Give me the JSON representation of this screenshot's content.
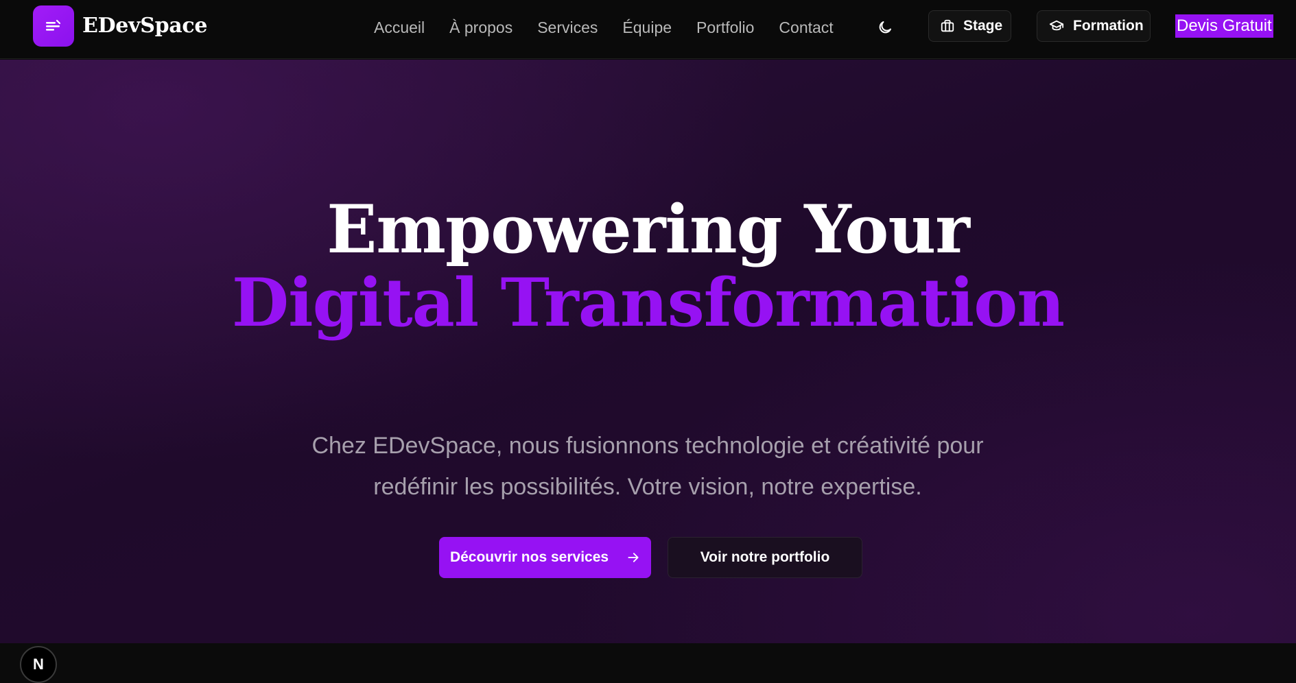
{
  "brand": {
    "name": "EDevSpace",
    "logo_icon": "menu-lines-icon",
    "accent_color": "#9612f3"
  },
  "nav": {
    "links": [
      "Accueil",
      "À propos",
      "Services",
      "Équipe",
      "Portfolio",
      "Contact"
    ],
    "theme_toggle_icon": "moon-icon",
    "stage": {
      "label": "Stage",
      "icon": "briefcase-icon"
    },
    "formation": {
      "label": "Formation",
      "icon": "graduation-cap-icon"
    },
    "devis": {
      "label": "Devis Gratuit"
    }
  },
  "hero": {
    "title_line_1": "Empowering Your",
    "title_line_2": "Digital Transformation",
    "subtitle": "Chez EDevSpace, nous fusionnons technologie et créativité pour redéfinir les possibilités. Votre vision, notre expertise.",
    "primary_cta": {
      "label": "Découvrir nos services",
      "icon": "arrow-right-icon"
    },
    "secondary_cta": {
      "label": "Voir notre portfolio"
    }
  },
  "dev_badge": {
    "label": "N",
    "icon": "nextjs-icon"
  }
}
